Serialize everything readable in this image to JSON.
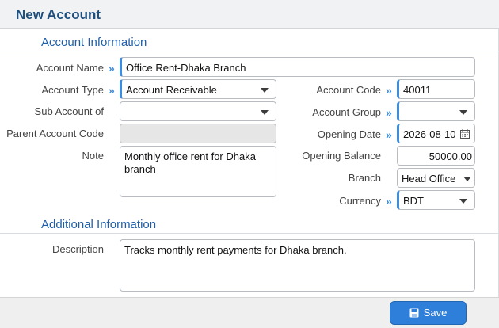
{
  "header": {
    "title": "New Account"
  },
  "sections": {
    "account_info": "Account Information",
    "additional_info": "Additional Information"
  },
  "fields": {
    "account_name": {
      "label": "Account Name",
      "value": "Office Rent-Dhaka Branch"
    },
    "account_type": {
      "label": "Account Type",
      "value": "Account Receivable"
    },
    "sub_account_of": {
      "label": "Sub Account of",
      "value": ""
    },
    "parent_account_code": {
      "label": "Parent Account Code",
      "value": ""
    },
    "note": {
      "label": "Note",
      "value": "Monthly office rent for Dhaka branch"
    },
    "account_code": {
      "label": "Account Code",
      "value": "40011"
    },
    "account_group": {
      "label": "Account Group",
      "value": ""
    },
    "opening_date": {
      "label": "Opening Date",
      "value": "2026-08-10"
    },
    "opening_balance": {
      "label": "Opening Balance",
      "value": "50000.00"
    },
    "branch": {
      "label": "Branch",
      "value": "Head Office"
    },
    "currency": {
      "label": "Currency",
      "value": "BDT"
    },
    "description": {
      "label": "Description",
      "value": "Tracks monthly rent payments for Dhaka branch."
    }
  },
  "actions": {
    "save_label": "Save"
  },
  "icons": {
    "required": "double-chevron-right-icon",
    "dropdown": "caret-down-icon",
    "calendar": "calendar-icon",
    "save": "floppy-disk-icon"
  },
  "colors": {
    "accent": "#3b8de0",
    "title": "#1f4f7e",
    "section": "#1e5ea8",
    "button": "#2e7fd9"
  }
}
